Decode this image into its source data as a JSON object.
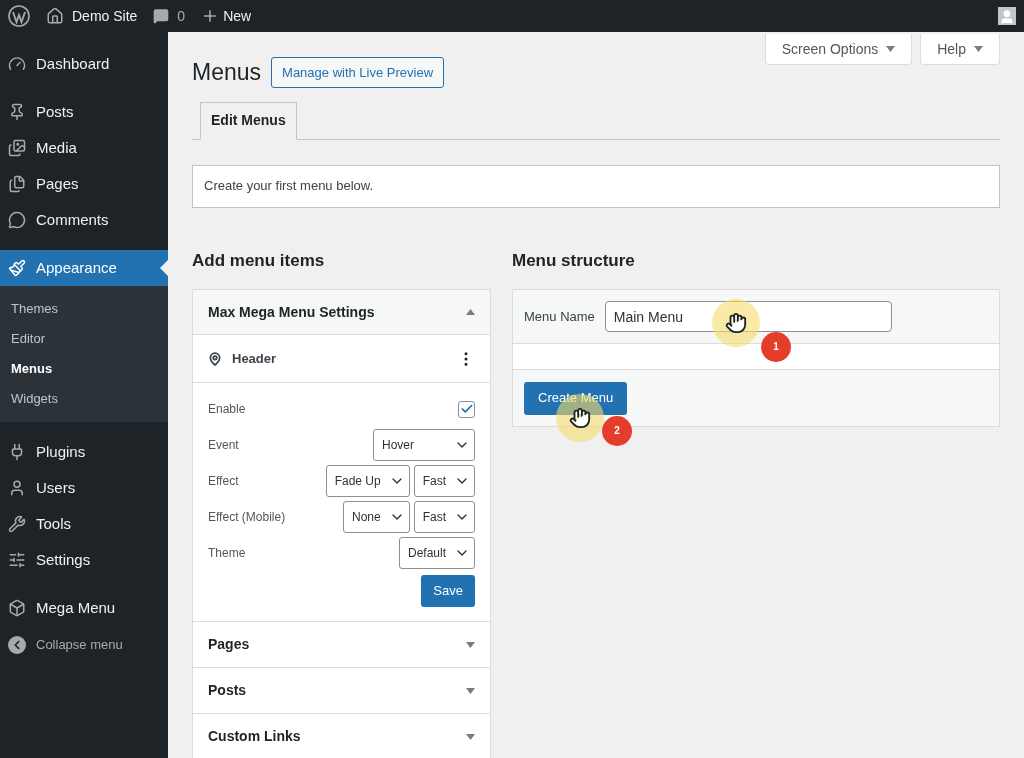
{
  "admin_bar": {
    "site_name": "Demo Site",
    "comments_count": "0",
    "new_label": "New"
  },
  "sidebar": {
    "items": [
      {
        "label": "Dashboard",
        "selected": false
      },
      {
        "label": "Posts",
        "selected": false
      },
      {
        "label": "Media",
        "selected": false
      },
      {
        "label": "Pages",
        "selected": false
      },
      {
        "label": "Comments",
        "selected": false
      },
      {
        "label": "Appearance",
        "selected": true,
        "children": [
          {
            "label": "Themes",
            "selected": false
          },
          {
            "label": "Editor",
            "selected": false
          },
          {
            "label": "Menus",
            "selected": true
          },
          {
            "label": "Widgets",
            "selected": false
          }
        ]
      },
      {
        "label": "Plugins",
        "selected": false
      },
      {
        "label": "Users",
        "selected": false
      },
      {
        "label": "Tools",
        "selected": false
      },
      {
        "label": "Settings",
        "selected": false
      },
      {
        "label": "Mega Menu",
        "selected": false
      }
    ],
    "collapse_label": "Collapse menu"
  },
  "header": {
    "title": "Menus",
    "live_preview_button": "Manage with Live Preview",
    "screen_options": "Screen Options",
    "help": "Help"
  },
  "tabs": [
    {
      "label": "Edit Menus",
      "selected": true
    }
  ],
  "notice": "Create your first menu below.",
  "add_items": {
    "heading": "Add menu items",
    "sections": [
      {
        "title": "Max Mega Menu Settings",
        "expanded": true,
        "location": "Header",
        "fields": [
          {
            "kind": "checkbox",
            "label": "Enable",
            "checked": true
          },
          {
            "kind": "select",
            "label": "Event",
            "values": [
              "Hover"
            ]
          },
          {
            "kind": "select",
            "label": "Effect",
            "values": [
              "Fade Up",
              "Fast"
            ]
          },
          {
            "kind": "select",
            "label": "Effect (Mobile)",
            "values": [
              "None",
              "Fast"
            ]
          },
          {
            "kind": "select",
            "label": "Theme",
            "values": [
              "Default"
            ]
          }
        ],
        "save_button": "Save"
      },
      {
        "title": "Pages",
        "expanded": false
      },
      {
        "title": "Posts",
        "expanded": false
      },
      {
        "title": "Custom Links",
        "expanded": false
      }
    ]
  },
  "menu_structure": {
    "heading": "Menu structure",
    "name_label": "Menu Name",
    "name_value": "Main Menu",
    "create_button": "Create Menu"
  },
  "annotations": [
    {
      "label": "1"
    },
    {
      "label": "2"
    }
  ]
}
